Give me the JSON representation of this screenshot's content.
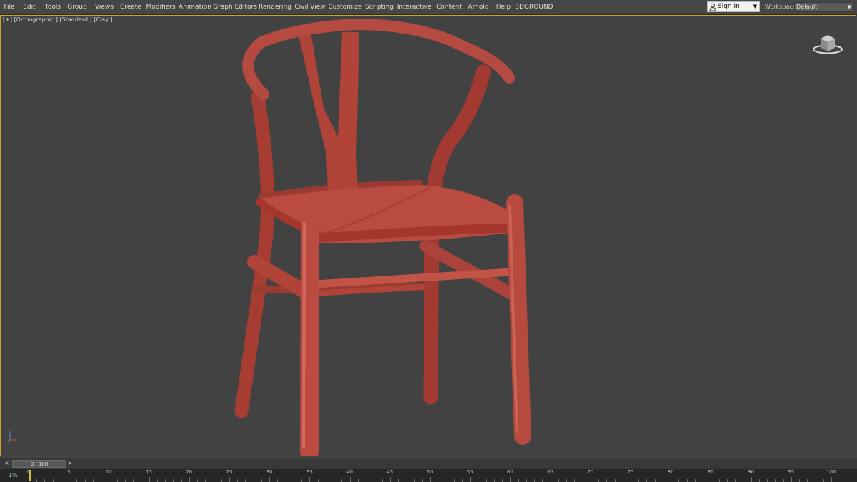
{
  "menu": [
    "File",
    "Edit",
    "Tools",
    "Group",
    "Views",
    "Create",
    "Modifiers",
    "Animation",
    "Graph Editors",
    "Rendering",
    "Civil View",
    "Customize",
    "Scripting",
    "Interactive",
    "Content",
    "Arnold",
    "Help",
    "3DGROUND"
  ],
  "signin": {
    "label": "Sign In"
  },
  "workspace": {
    "label": "Workspaces:",
    "value": "Default"
  },
  "viewport": {
    "label": "[+] [Orthographic ] [Standard ] [Clay ]"
  },
  "time_slider": {
    "value": "0 / 100",
    "prev": "<",
    "next": ">"
  },
  "trackbar": {
    "icon_label": "1⅝",
    "labels": [
      "0",
      "5",
      "10",
      "15",
      "20",
      "25",
      "30",
      "35",
      "40",
      "45",
      "50",
      "55",
      "60",
      "65",
      "70",
      "75",
      "80",
      "85",
      "90",
      "95",
      "100"
    ]
  },
  "colors": {
    "clay": "#b94b40",
    "viewport_border": "#c8a82c",
    "time_marker": "#d4c236"
  },
  "icons": [
    "user-icon",
    "chevron-down-icon",
    "view-cube-icon",
    "axis-tripod-icon"
  ]
}
